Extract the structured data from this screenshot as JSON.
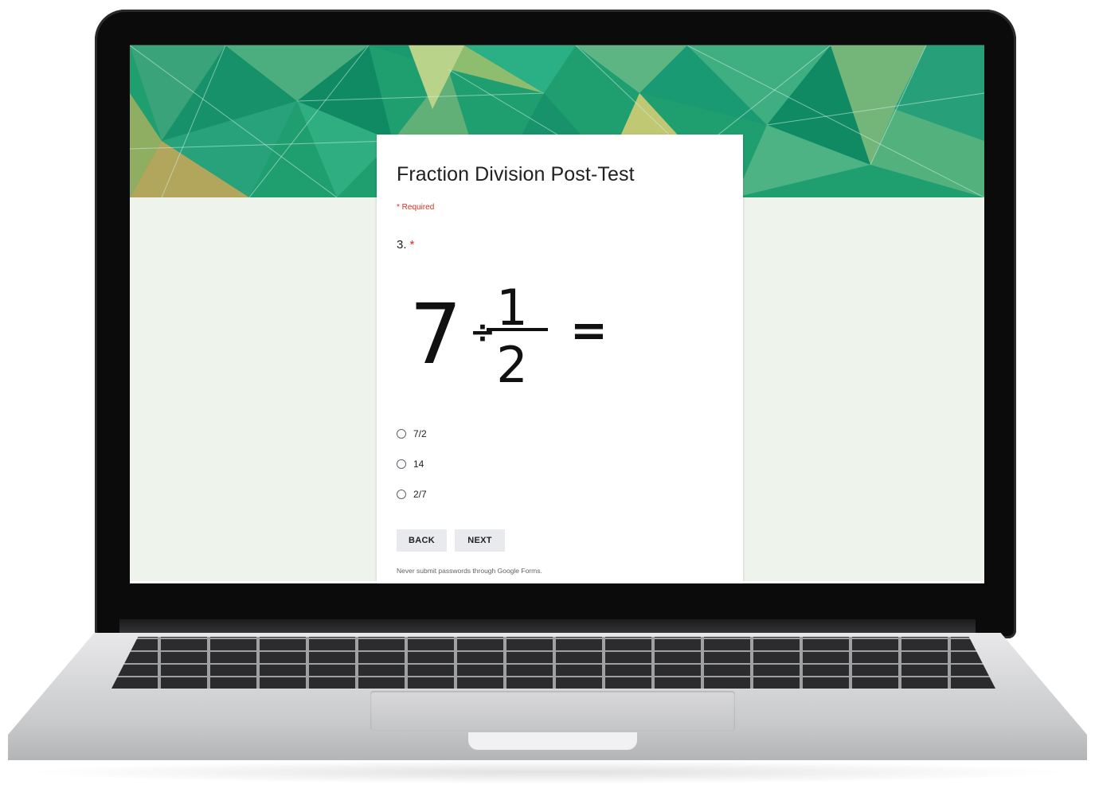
{
  "form": {
    "title": "Fraction Division Post-Test",
    "required_note": "* Required",
    "question_number": "3.",
    "required_star": "*",
    "expression": {
      "whole": "7",
      "operator": "÷",
      "numerator": "1",
      "denominator": "2",
      "equals": "="
    },
    "options": [
      "7/2",
      "14",
      "2/7"
    ],
    "back_label": "BACK",
    "next_label": "NEXT",
    "footer_note": "Never submit passwords through Google Forms."
  },
  "colors": {
    "banner": "#1f9e6f",
    "page_background": "#eef3ec",
    "required": "#d93025"
  },
  "icons": {
    "radio": "radio-button-unchecked-icon"
  }
}
